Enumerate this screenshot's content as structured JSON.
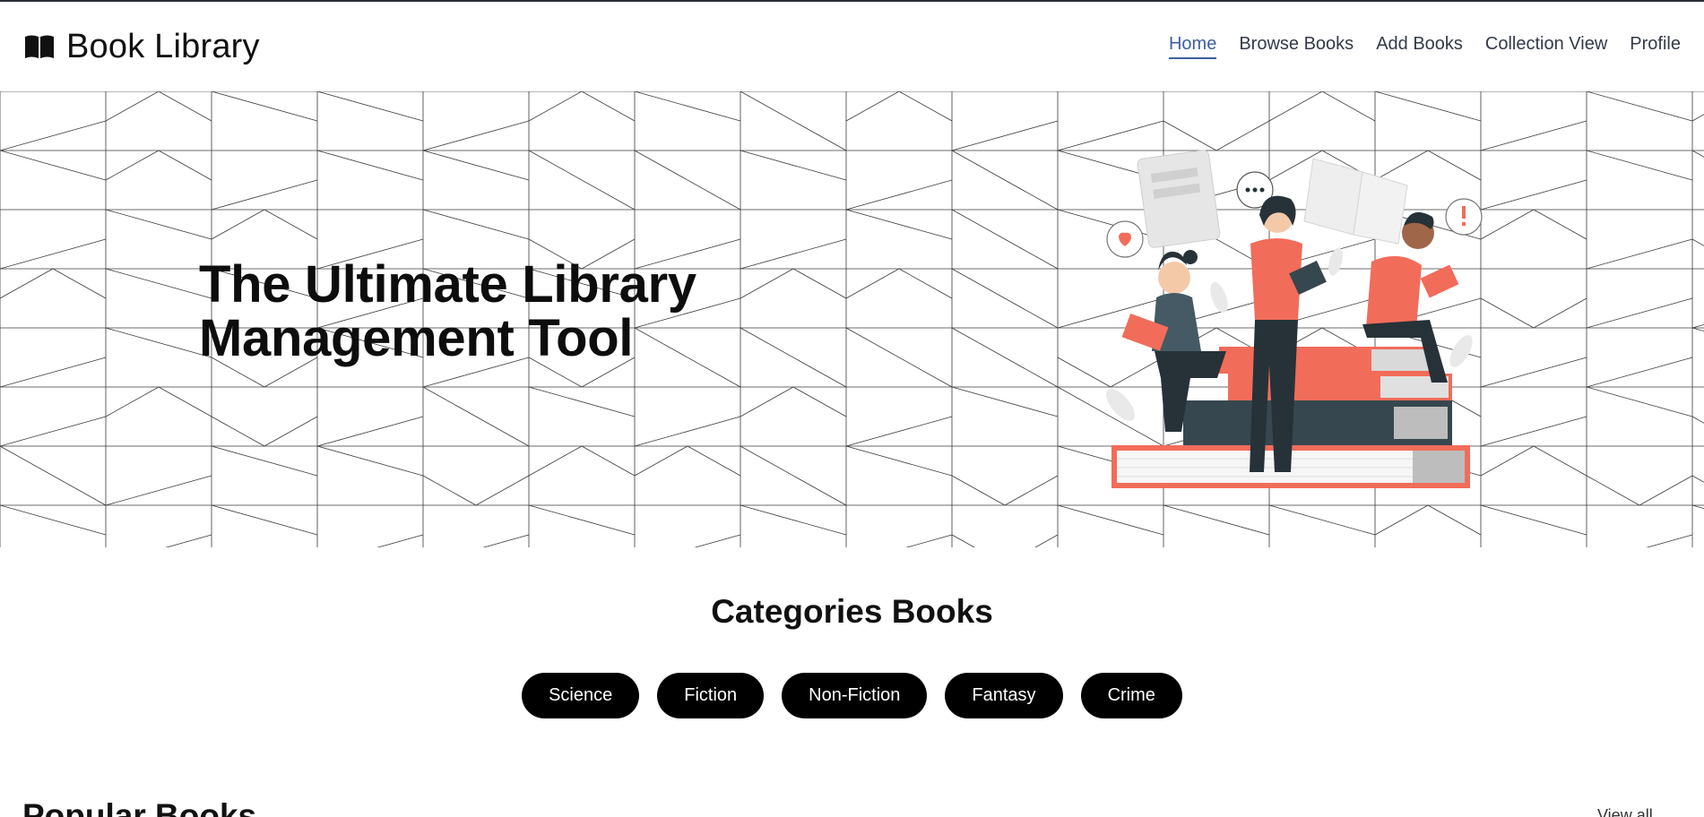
{
  "brand": {
    "name": "Book Library",
    "icon": "open-book-icon"
  },
  "nav": {
    "items": [
      {
        "label": "Home",
        "active": true
      },
      {
        "label": "Browse Books",
        "active": false
      },
      {
        "label": "Add Books",
        "active": false
      },
      {
        "label": "Collection View",
        "active": false
      },
      {
        "label": "Profile",
        "active": false
      }
    ],
    "active_color": "#3d5f9e"
  },
  "hero": {
    "title_line1": "The Ultimate Library",
    "title_line2": "Management Tool",
    "illustration": "people-reading-on-books-illustration",
    "accent_color": "#f26c5a",
    "dark_color": "#263238"
  },
  "categories": {
    "title": "Categories Books",
    "items": [
      "Science",
      "Fiction",
      "Non-Fiction",
      "Fantasy",
      "Crime"
    ]
  },
  "popular": {
    "title": "Popular Books",
    "view_all": "View all"
  }
}
